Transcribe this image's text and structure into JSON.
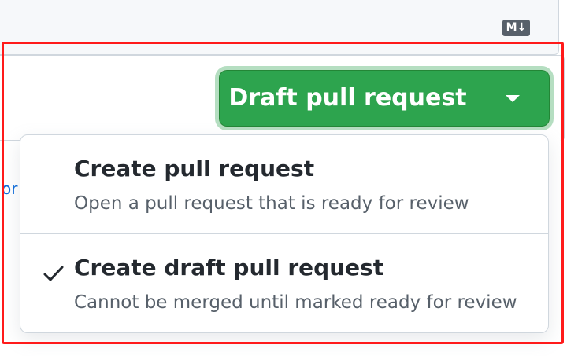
{
  "editor": {
    "markdown_badge": "M↓"
  },
  "background": {
    "link_fragment": "or"
  },
  "split_button": {
    "main_label": "Draft pull request",
    "caret_icon": "triangle-down-icon",
    "accent_color": "#2da44e"
  },
  "menu": {
    "items": [
      {
        "title": "Create pull request",
        "description": "Open a pull request that is ready for review",
        "selected": false
      },
      {
        "title": "Create draft pull request",
        "description": "Cannot be merged until marked ready for review",
        "selected": true,
        "icon": "check-icon"
      }
    ]
  },
  "annotation": {
    "highlight_color": "#ff1a1a"
  }
}
